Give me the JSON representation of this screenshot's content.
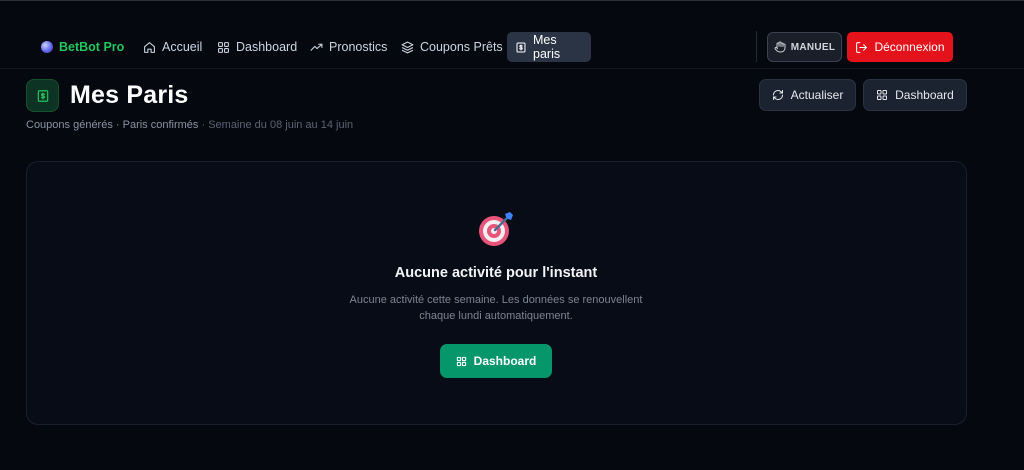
{
  "nav": {
    "brand": "BetBot Pro",
    "items": [
      {
        "label": "Accueil",
        "icon": "home-icon"
      },
      {
        "label": "Dashboard",
        "icon": "grid-icon"
      },
      {
        "label": "Pronostics",
        "icon": "trending-up-icon"
      },
      {
        "label": "Coupons Prêts",
        "icon": "layers-icon"
      },
      {
        "label": "Mes paris",
        "icon": "receipt-icon",
        "active": true
      }
    ],
    "mode_label": "MANUEL",
    "logout_label": "Déconnexion"
  },
  "header": {
    "title": "Mes Paris",
    "subtitle_main": "Coupons générés · Paris confirmés",
    "subtitle_dim": " · Semaine du 08 juin au 14 juin",
    "refresh_label": "Actualiser",
    "dashboard_label": "Dashboard"
  },
  "empty_state": {
    "icon": "target-icon",
    "title": "Aucune activité pour l'instant",
    "description": "Aucune activité cette semaine. Les données se renouvellent chaque lundi automatiquement.",
    "button_label": "Dashboard"
  },
  "colors": {
    "background": "#05080f",
    "brand": "#22c55e",
    "active_nav": "#2b3445",
    "logout": "#e3121b",
    "cta": "#059669"
  }
}
